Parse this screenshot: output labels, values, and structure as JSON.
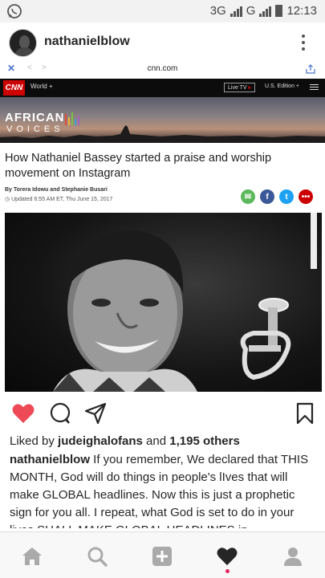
{
  "status_bar": {
    "network": "3G",
    "network_small": "3G",
    "network2": "G",
    "time": "12:13",
    "icons": [
      "whatsapp-icon",
      "signal-icon",
      "signal-icon",
      "battery-icon"
    ]
  },
  "header": {
    "username": "nathanielblow",
    "more_icon": "vertical-dots-icon"
  },
  "post_image": {
    "browser": {
      "close": "✕",
      "url": "cnn.com"
    },
    "cnn": {
      "logo": "CNN",
      "section": "World +",
      "live_tv": "Live TV",
      "edition": "U.S. Edition +",
      "banner_title": "AFRICAN",
      "banner_subtitle": "VOICES",
      "headline": "How Nathaniel Bassey started a praise and worship movement on Instagram",
      "byline": "By Torera Idowu and Stephanie Busari",
      "updated": "Updated 6:55 AM ET, Thu June 15, 2017",
      "share_colors": {
        "email": "#5cb85c",
        "facebook": "#3b5998",
        "twitter": "#1da1f2",
        "more": "#cc0000"
      }
    }
  },
  "actions": {
    "like_icon": "heart-filled-icon",
    "comment_icon": "comment-icon",
    "share_icon": "send-icon",
    "save_icon": "bookmark-icon",
    "like_color": "#ed4956"
  },
  "likes": {
    "prefix": "Liked by ",
    "user": "judeighalofans",
    "middle": " and ",
    "count": "1,195 others"
  },
  "caption": {
    "user": "nathanielblow",
    "text": " If you remember, We declared that THIS MONTH, God will do things in people's lIves that will make GLOBAL headlines. Now this is just a prophetic sign for you all. I repeat, what God is set to do in your lives SHALL MAKE GLOBAL HEADLINES in"
  },
  "bottom_nav": {
    "items": [
      "home-icon",
      "search-icon",
      "add-post-icon",
      "activity-heart-icon",
      "profile-icon"
    ],
    "active_dot_color": "#e0245e"
  }
}
